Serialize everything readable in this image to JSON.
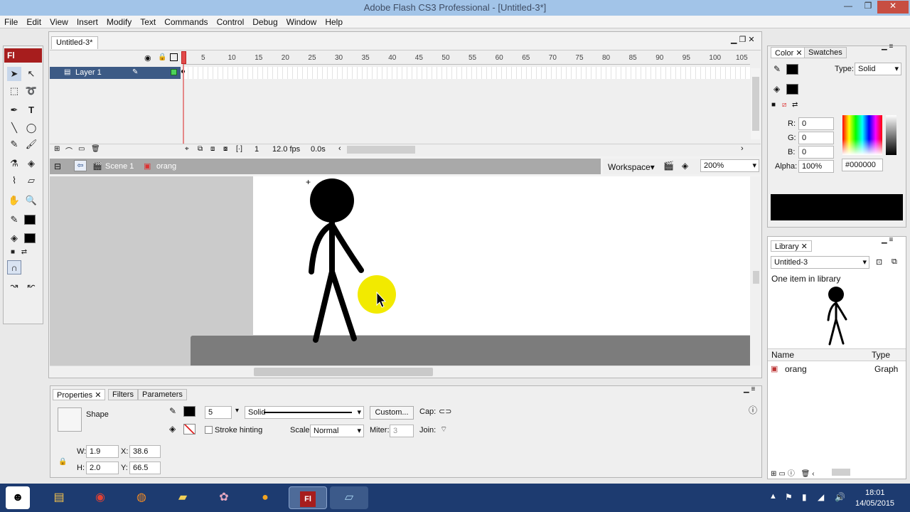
{
  "window": {
    "title": "Adobe Flash CS3 Professional - [Untitled-3*]",
    "controls": [
      "—",
      "❐",
      "✕"
    ]
  },
  "menu": [
    "File",
    "Edit",
    "View",
    "Insert",
    "Modify",
    "Text",
    "Commands",
    "Control",
    "Debug",
    "Window",
    "Help"
  ],
  "tools": {
    "logo": "Fl"
  },
  "document": {
    "tab": "Untitled-3*",
    "layer_name": "Layer 1",
    "ruler_numbers": [
      "5",
      "10",
      "15",
      "20",
      "25",
      "30",
      "35",
      "40",
      "45",
      "50",
      "55",
      "60",
      "65",
      "70",
      "75",
      "80",
      "85",
      "90",
      "95",
      "100",
      "105"
    ],
    "current_frame": "1",
    "fps": "12.0 fps",
    "time": "0.0s",
    "breadcrumb_scene": "Scene 1",
    "breadcrumb_symbol": "orang",
    "workspace_label": "Workspace▾",
    "zoom": "200%"
  },
  "properties": {
    "tabs": [
      "Properties",
      "Filters",
      "Parameters"
    ],
    "type_label": "Shape",
    "stroke_height": "5",
    "stroke_style": "Solid",
    "custom_button": "Custom...",
    "cap_label": "Cap:",
    "stroke_hinting": "Stroke hinting",
    "scale_label": "Scale:",
    "scale_value": "Normal",
    "miter_label": "Miter:",
    "miter_value": "3",
    "join_label": "Join:",
    "w_label": "W:",
    "w_value": "1.9",
    "x_label": "X:",
    "x_value": "38.6",
    "h_label": "H:",
    "h_value": "2.0",
    "y_label": "Y:",
    "y_value": "66.5"
  },
  "color_panel": {
    "tabs": [
      "Color",
      "Swatches"
    ],
    "type_label": "Type:",
    "type_value": "Solid",
    "r_label": "R:",
    "r_value": "0",
    "g_label": "G:",
    "g_value": "0",
    "b_label": "B:",
    "b_value": "0",
    "alpha_label": "Alpha:",
    "alpha_value": "100%",
    "hex_value": "#000000"
  },
  "library": {
    "tab": "Library",
    "document": "Untitled-3",
    "count": "One item in library",
    "col_name": "Name",
    "col_type": "Type",
    "item_name": "orang",
    "item_type": "Graph"
  },
  "taskbar": {
    "time": "18:01",
    "date": "14/05/2015",
    "active_app": "Fl"
  }
}
